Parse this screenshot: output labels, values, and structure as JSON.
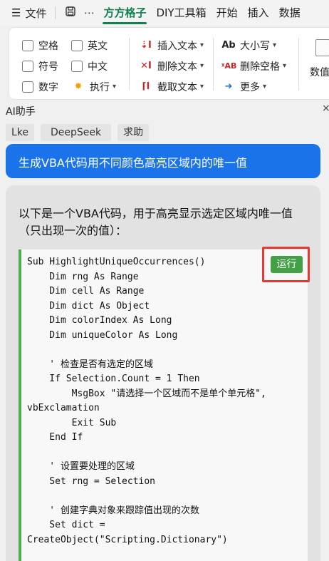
{
  "topbar": {
    "menu_icon": "☰",
    "file_label": "文件",
    "tabs": [
      {
        "label": "方方格子"
      },
      {
        "label": "DIY工具箱"
      },
      {
        "label": "开始"
      },
      {
        "label": "插入"
      },
      {
        "label": "数据"
      }
    ]
  },
  "ribbon": {
    "checkboxes_col1": [
      "空格",
      "符号",
      "数字"
    ],
    "checkboxes_col2": [
      "英文",
      "中文"
    ],
    "execute_label": "执行",
    "text_ops": [
      "插入文本",
      "删除文本",
      "截取文本"
    ],
    "case_label": "大小写",
    "case_icon_text": "Ab",
    "delete_space_label": "删除空格",
    "delete_space_icon_text": "ᵡAB",
    "more_label": "更多",
    "numeric_label": "数值"
  },
  "ai_panel": {
    "title": "AI助手",
    "close_icon": "×",
    "chips": [
      "Lke",
      "DeepSeek",
      "求助"
    ],
    "user_message": "生成VBA代码用不同颜色高亮区域内的唯一值",
    "answer_intro": "以下是一个VBA代码，用于高亮显示选定区域内唯一值（只出现一次的值）：",
    "run_button": "运行",
    "code": "Sub HighlightUniqueOccurrences()\n    Dim rng As Range\n    Dim cell As Range\n    Dim dict As Object\n    Dim colorIndex As Long\n    Dim uniqueColor As Long\n\n    ' 检查是否有选定的区域\n    If Selection.Count = 1 Then\n        MsgBox \"请选择一个区域而不是单个单元格\",\nvbExclamation\n        Exit Sub\n    End If\n\n    ' 设置要处理的区域\n    Set rng = Selection\n\n    ' 创建字典对象来跟踪值出现的次数\n    Set dict =\nCreateObject(\"Scripting.Dictionary\")"
  }
}
